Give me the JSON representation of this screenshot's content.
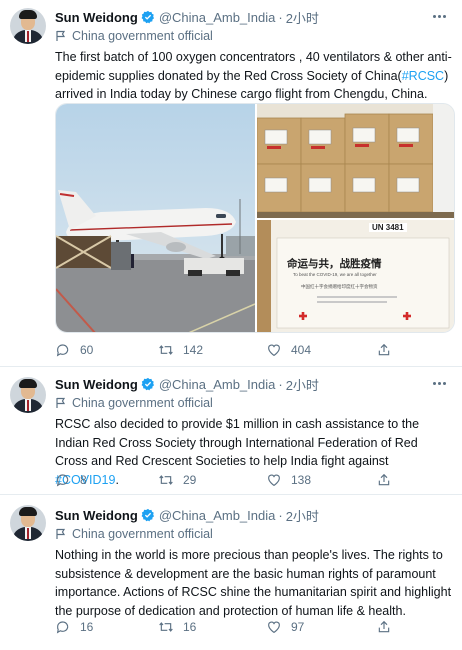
{
  "colors": {
    "accent": "#1da1f2",
    "muted": "#5b7083",
    "text": "#0f1419",
    "divider": "#e6ecf0"
  },
  "tweets": [
    {
      "author": "Sun Weidong",
      "handle": "@China_Amb_India",
      "separator": "·",
      "time": "2小时",
      "label": "China government official",
      "text_parts": [
        "The first batch of 100 oxygen concentrators , 40 ventilators & other anti-epidemic supplies donated by the Red Cross Society of China(",
        "#RCSC",
        ") arrived in India today by Chinese cargo flight from Chengdu, China."
      ],
      "media": {
        "photos": [
          "cargo-plane-photo",
          "stacked-boxes-photo",
          "printed-box-label-photo"
        ],
        "box_text": [
          "UN 3481",
          "命运与共，战胜疫情",
          "To beat the COVID-19, we are all together",
          "中国红十字会捐赠给印度红十字会物资"
        ]
      },
      "replies": "60",
      "retweets": "142",
      "likes": "404"
    },
    {
      "author": "Sun Weidong",
      "handle": "@China_Amb_India",
      "separator": "·",
      "time": "2小时",
      "label": "China government official",
      "text_parts": [
        "RCSC also decided to provide  $1 million in cash assistance to the Indian Red Cross Society through International Federation of Red Cross and Red Crescent Societies to help India fight against ",
        "#COVID19",
        "."
      ],
      "replies": "8",
      "retweets": "29",
      "likes": "138"
    },
    {
      "author": "Sun Weidong",
      "handle": "@China_Amb_India",
      "separator": "·",
      "time": "2小时",
      "label": "China government official",
      "text_parts": [
        "Nothing in the world is more precious than people's lives. The rights to subsistence & development are the basic human rights of paramount importance. Actions of RCSC shine the humanitarian spirit and highlight the purpose of dedication and protection of human life & health."
      ],
      "replies": "16",
      "retweets": "16",
      "likes": "97"
    }
  ]
}
